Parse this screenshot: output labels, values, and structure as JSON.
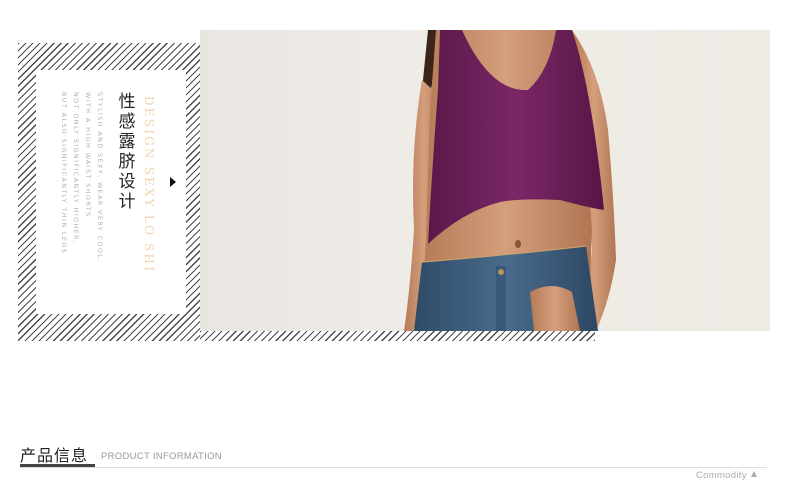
{
  "banner": {
    "zh_title": "性感露脐设计",
    "en_title": "DESIGN SEXY LO SHI",
    "en_copy_lines": [
      "STYLISH AND SEXY, WEAR VERY COOL,",
      "WITH A HIGH WAIST SHORTS",
      "NOT ONLY SIGNIFICANTLY HIGHER,",
      "BUT ALSO SIGNIFICANTLY THIN LEGS"
    ],
    "photo": "model-wearing-purple-crop-top-and-denim-shorts"
  },
  "section": {
    "title_zh": "产品信息",
    "title_en": "PRODUCT INFORMATION",
    "commodity_label": "Commodity"
  },
  "colors": {
    "accent_peach": "#f0d3b0",
    "hatch": "#4a4a4a",
    "top_purple": "#6b1f5a",
    "denim": "#3d5c7d"
  }
}
